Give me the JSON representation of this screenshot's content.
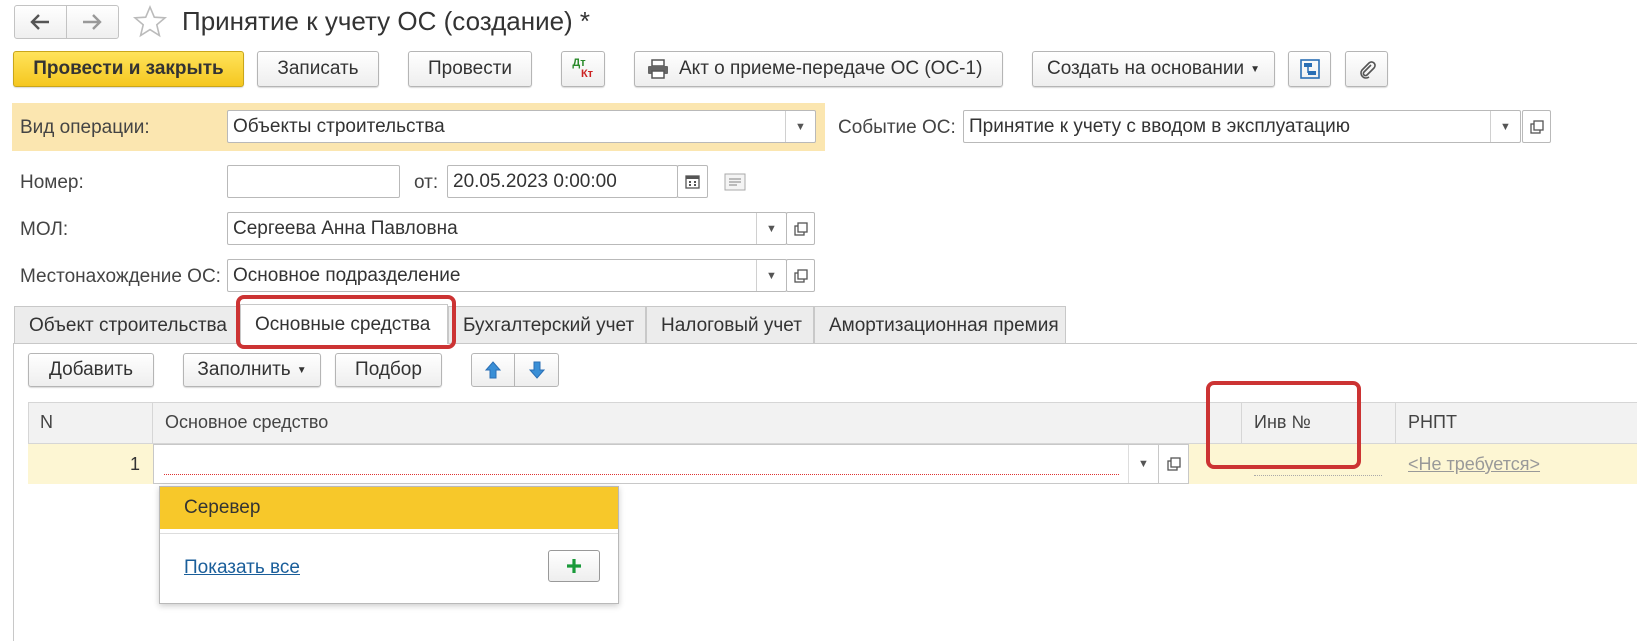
{
  "window": {
    "title": "Принятие к учету ОС (создание) *",
    "nav_back_icon": "arrow-left-icon",
    "nav_forward_icon": "arrow-right-icon",
    "favorite_icon": "star-icon"
  },
  "toolbar": {
    "post_close": "Провести и закрыть",
    "save": "Записать",
    "post": "Провести",
    "dtkt_top": "Дт",
    "dtkt_bottom": "Кт",
    "act": "Акт о приеме-передаче ОС (ОС-1)",
    "create_based": "Создать на основании",
    "structure_icon": "structure-icon",
    "attach_icon": "paperclip-icon"
  },
  "form": {
    "operation_label": "Вид операции:",
    "operation_value": "Объекты строительства",
    "event_label": "Событие ОС:",
    "event_value": "Принятие к учету с вводом в эксплуатацию",
    "number_label": "Номер:",
    "number_value": "",
    "date_label": "от:",
    "date_value": "20.05.2023  0:00:00",
    "mol_label": "МОЛ:",
    "mol_value": "Сергеева Анна Павловна",
    "location_label": "Местонахождение ОС:",
    "location_value": "Основное подразделение"
  },
  "tabs": [
    {
      "label": "Объект строительства"
    },
    {
      "label": "Основные средства"
    },
    {
      "label": "Бухгалтерский учет"
    },
    {
      "label": "Налоговый учет"
    },
    {
      "label": "Амортизационная премия"
    }
  ],
  "table_toolbar": {
    "add": "Добавить",
    "fill": "Заполнить",
    "select": "Подбор"
  },
  "table": {
    "columns": [
      "N",
      "Основное средство",
      "Инв №",
      "РНПТ"
    ],
    "rows": [
      {
        "n": "1",
        "asset": "",
        "inv": "",
        "rnpt": "<Не требуется>"
      }
    ]
  },
  "dropdown": {
    "item": "Серевер",
    "show_all": "Показать все",
    "add_icon": "plus-icon"
  },
  "colors": {
    "highlight_row": "#fdf6d3",
    "primary_button": "#f5c720",
    "annotation": "#cc3333",
    "dropdown_selected": "#f7c82a"
  }
}
